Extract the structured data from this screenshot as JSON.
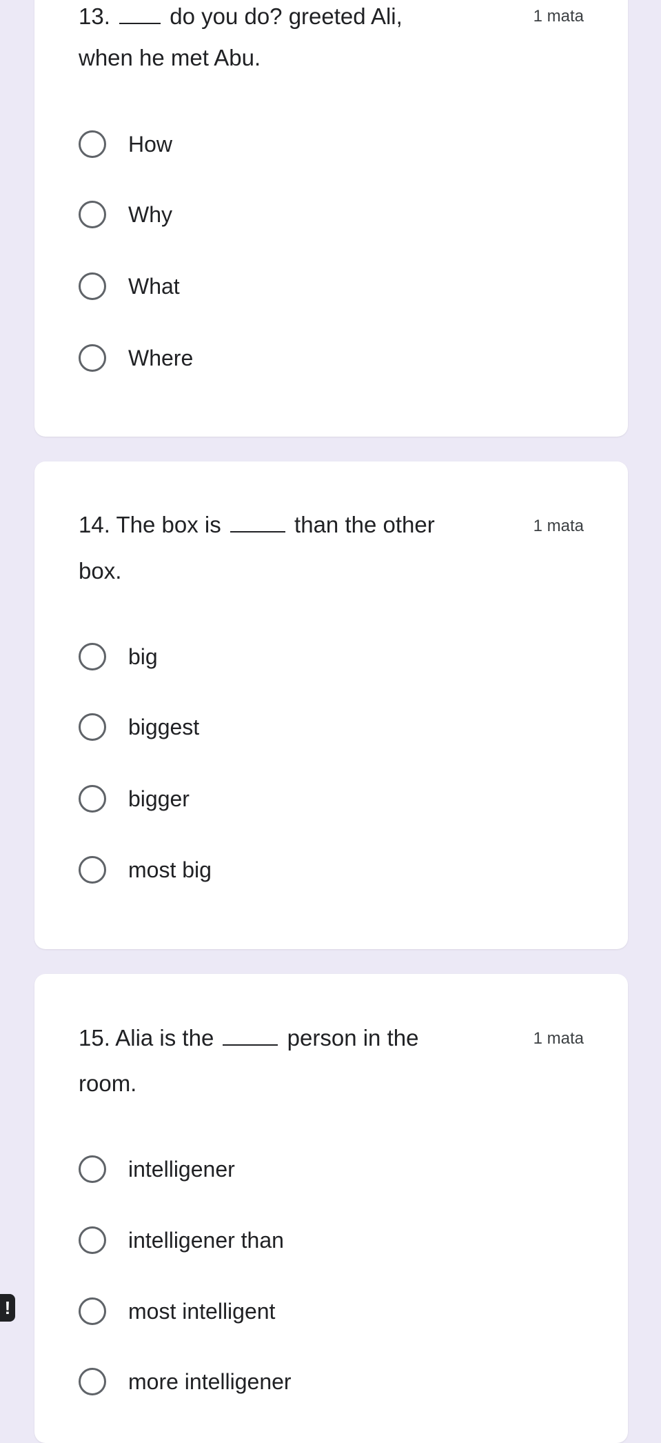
{
  "questions": [
    {
      "number": "13.",
      "line1_after_blank": "do you do? greeted Ali,",
      "line2": "when he met Abu.",
      "points": "1 mata",
      "options": [
        "How",
        "Why",
        "What",
        "Where"
      ]
    },
    {
      "number": "14.",
      "line1_before_blank": "The box is",
      "line1_after_blank": "than the other",
      "line2": "box.",
      "points": "1 mata",
      "options": [
        "big",
        "biggest",
        "bigger",
        "most big"
      ]
    },
    {
      "number": "15.",
      "line1_before_blank": "Alia is the",
      "line1_after_blank": "person in the",
      "line2": "room.",
      "points": "1 mata",
      "options": [
        "intelligener",
        "intelligener than",
        "most intelligent",
        "more intelligener"
      ]
    }
  ],
  "alert": {
    "icon": "exclamation-icon",
    "glyph": "!"
  }
}
